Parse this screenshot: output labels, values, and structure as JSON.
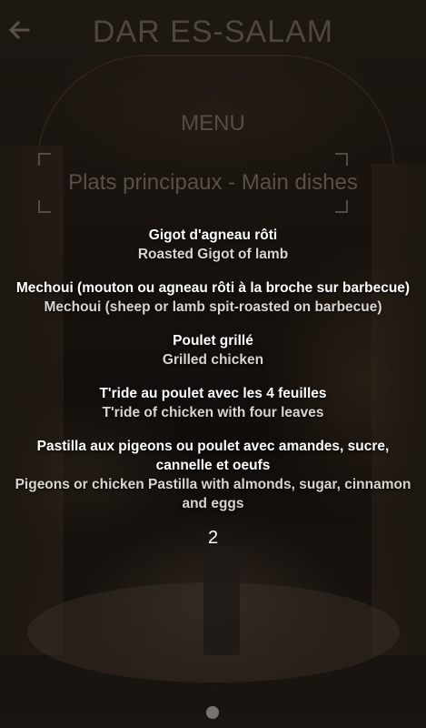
{
  "header": {
    "title": "DAR ES-SALAM",
    "back_icon": "back-arrow-icon"
  },
  "menu_heading": "MENU",
  "section": {
    "title": "Plats principaux - Main dishes"
  },
  "dishes": [
    {
      "fr": "Gigot d'agneau rôti",
      "en": "Roasted Gigot of lamb"
    },
    {
      "fr": "Mechoui (mouton ou agneau rôti à la broche sur barbecue)",
      "en": "Mechoui (sheep or lamb spit-roasted on barbecue)"
    },
    {
      "fr": "Poulet grillé",
      "en": "Grilled chicken"
    },
    {
      "fr": "T'ride au poulet avec les 4 feuilles",
      "en": "T'ride of chicken with four leaves"
    },
    {
      "fr": "Pastilla aux pigeons ou poulet avec amandes, sucre, cannelle et oeufs",
      "en": "Pigeons or chicken Pastilla with almonds, sugar, cinnamon and eggs"
    }
  ],
  "page_number": "2",
  "colors": {
    "text_primary": "#ffffff",
    "text_secondary": "#d9d4cf",
    "background": "#17120e"
  }
}
